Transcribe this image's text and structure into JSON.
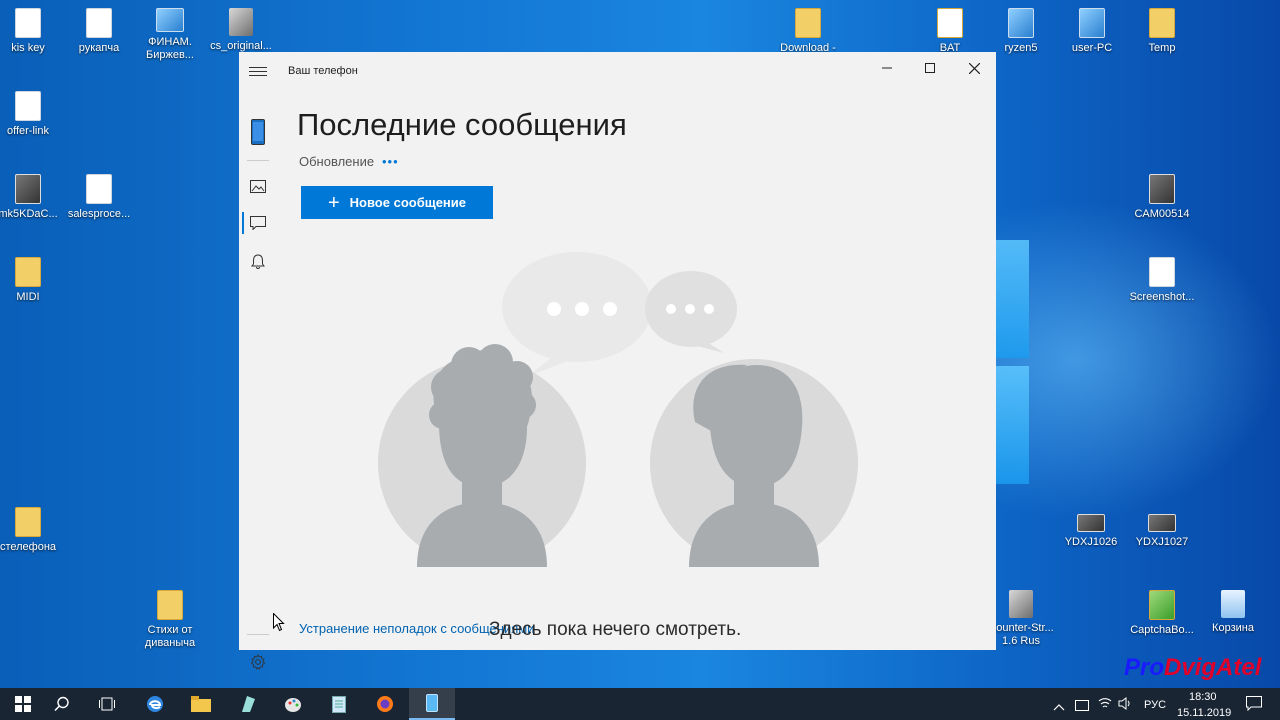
{
  "desktop": {
    "icons": [
      {
        "id": "kis-key",
        "label": "kis key",
        "type": "doc"
      },
      {
        "id": "rukapcha",
        "label": "рукапча",
        "type": "doc"
      },
      {
        "id": "finam",
        "label": "ФИНАМ. Биржев...",
        "type": "shortcut"
      },
      {
        "id": "cs-original",
        "label": "cs_original...",
        "type": "game"
      },
      {
        "id": "download",
        "label": "Download -",
        "type": "folder"
      },
      {
        "id": "bat",
        "label": "BAT",
        "type": "folder"
      },
      {
        "id": "ryzen5",
        "label": "ryzen5",
        "type": "shortcut"
      },
      {
        "id": "user-pc",
        "label": "user-PC",
        "type": "shortcut"
      },
      {
        "id": "temp",
        "label": "Temp",
        "type": "folder"
      },
      {
        "id": "offer-link",
        "label": "offer-link",
        "type": "doc"
      },
      {
        "id": "mk5kdac",
        "label": "mk5KDaC...",
        "type": "img"
      },
      {
        "id": "salesproce",
        "label": "salesproce...",
        "type": "doc"
      },
      {
        "id": "cam00514",
        "label": "CAM00514",
        "type": "img"
      },
      {
        "id": "midi",
        "label": "MIDI",
        "type": "folder"
      },
      {
        "id": "screenshot",
        "label": "Screenshot...",
        "type": "doc"
      },
      {
        "id": "stelefona",
        "label": "стелефона",
        "type": "folder"
      },
      {
        "id": "ydxj1026",
        "label": "YDXJ1026",
        "type": "img"
      },
      {
        "id": "ydxj1027",
        "label": "YDXJ1027",
        "type": "img"
      },
      {
        "id": "stikhi",
        "label": "Стихи от диваныча",
        "type": "folder"
      },
      {
        "id": "counter-strike",
        "label": "Counter-Str... 1.6 Rus",
        "type": "game"
      },
      {
        "id": "captchabo",
        "label": "CaptchaBo...",
        "type": "folder"
      },
      {
        "id": "korzina",
        "label": "Корзина",
        "type": "bin"
      }
    ]
  },
  "app": {
    "title": "Ваш телефон",
    "heading": "Последние сообщения",
    "status": "Обновление",
    "status_dots": "•••",
    "new_message_label": "Новое сообщение",
    "troubleshoot_link": "Устранение неполадок с сообщениями",
    "empty_state": "Здесь пока нечего смотреть.",
    "sidebar_icons": [
      "phone-icon",
      "photos-icon",
      "messages-icon",
      "notifications-icon",
      "settings-icon"
    ],
    "accent_color": "#0078d7"
  },
  "taskbar": {
    "buttons": [
      "start-icon",
      "search-icon",
      "task-view-icon",
      "edge-icon",
      "file-explorer-icon",
      "app-icon",
      "paint-icon",
      "notepad-icon",
      "firefox-icon",
      "your-phone-icon"
    ],
    "language": "РУС",
    "time": "18:30",
    "date": "15.11.2019"
  },
  "watermark": {
    "part1": "Pro",
    "part2": "DvigAtel",
    "color1": "#1a1aff",
    "color2": "#e0002a"
  }
}
